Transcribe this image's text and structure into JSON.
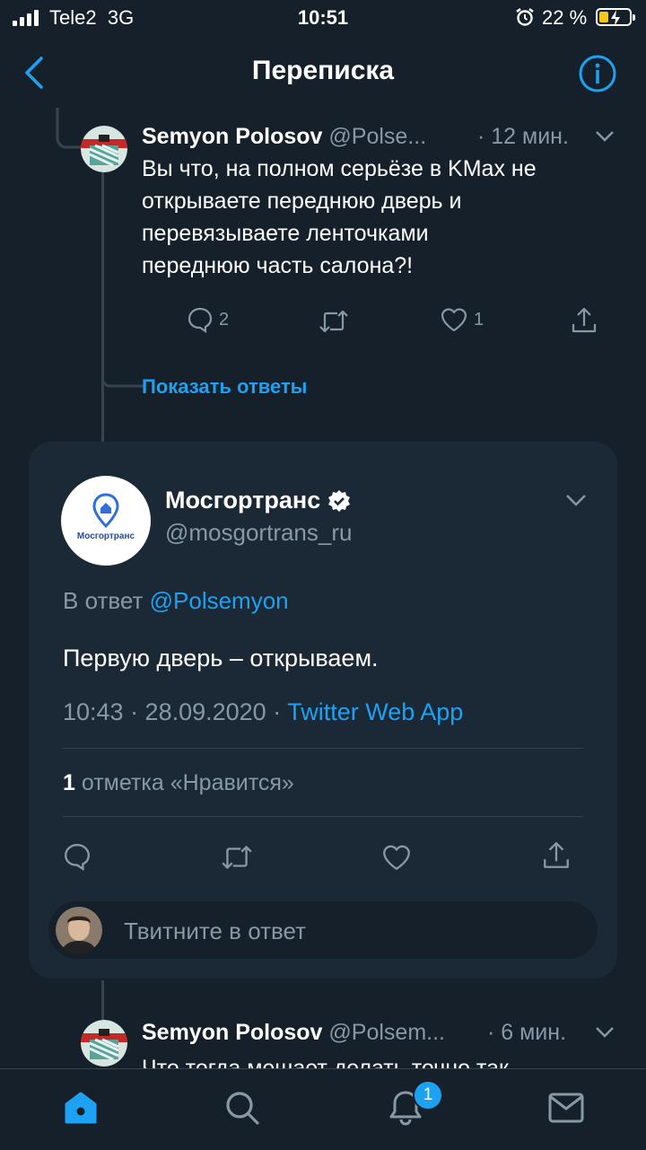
{
  "status_bar": {
    "carrier": "Tele2",
    "network": "3G",
    "time": "10:51",
    "battery": "22 %"
  },
  "header": {
    "title": "Переписка"
  },
  "tweet_prev": {
    "author_name": "Semyon Polosov",
    "author_handle": "@Polse...",
    "time": "· 12 мин.",
    "text_lines": [
      "Вы что, на полном серьёзе в KMax не",
      "открываете переднюю дверь и",
      "перевязываете ленточками",
      "переднюю часть салона?!"
    ],
    "reply_count": "2",
    "like_count": "1",
    "show_replies": "Показать ответы"
  },
  "focused_tweet": {
    "author_name": "Мосгортранс",
    "author_handle": "@mosgortrans_ru",
    "avatar_text": "Мосгортранс",
    "reply_to_prefix": "В ответ",
    "reply_to_handle": "@Polsemyon",
    "text": "Первую дверь – открываем.",
    "timestamp": "10:43 · 28.09.2020 ·",
    "source": "Twitter Web App",
    "likes_count": "1",
    "likes_label": "отметка «Нравится»",
    "reply_placeholder": "Твитните в ответ"
  },
  "tweet_next": {
    "author_name": "Semyon Polosov",
    "author_handle": "@Polsem...",
    "time": "· 6 мин.",
    "text_partial": "Что тогда мешает делать точно так"
  },
  "tab_bar": {
    "notifications_badge": "1"
  },
  "colors": {
    "background": "#15202b",
    "card": "#1b2836",
    "accent": "#1da1f2",
    "muted": "#8899a6"
  }
}
